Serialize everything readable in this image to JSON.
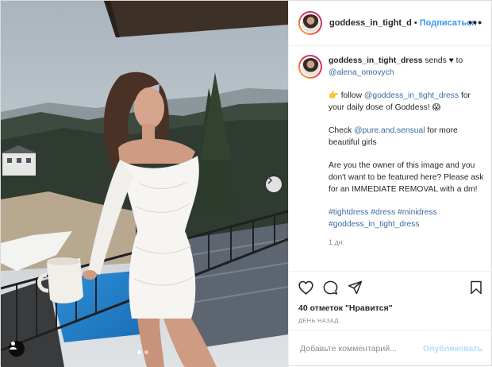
{
  "post": {
    "username_short": "goddess_in_tight_d",
    "separator": "•",
    "follow_label": "Подписаться",
    "more_label": "•••"
  },
  "caption": {
    "username": "goddess_in_tight_dress",
    "sends_text": " sends ",
    "heart": "♥",
    "to_text": " to",
    "mention_to": "@alena_omovych",
    "finger_emoji": "👉",
    "follow_text": " follow ",
    "follow_mention": "@goddess_in_tight_dress",
    "follow_rest": " for your daily dose of Goddess! ",
    "face_emoji": "😱",
    "check_text": "Check ",
    "check_mention": "@pure.and.sensual",
    "check_rest": " for more beautiful girls",
    "owner_text": "Are you the owner of this image and you don't want to be featured here? Please ask for an IMMEDIATE REMOVAL with a dm!",
    "hashtags": [
      "#tightdress",
      "#dress",
      "#minidress",
      "#goddess_in_tight_dress"
    ],
    "time": "1 дн."
  },
  "actions": {
    "likes": "40 отметок \"Нравится\"",
    "ago": "ДЕНЬ НАЗАД"
  },
  "comment": {
    "placeholder": "Добавьте комментарий...",
    "publish_label": "Опубликовать"
  },
  "carousel": {
    "slides": 2,
    "active": 0
  },
  "icons": [
    "like-icon",
    "comment-icon",
    "share-icon",
    "save-icon",
    "chevron-right-icon",
    "user-tag-icon",
    "more-icon"
  ],
  "colors": {
    "link": "#3897f0",
    "follow": "#3897f0",
    "publish_disabled": "#b2dffc",
    "muted": "#8e8e8e"
  }
}
